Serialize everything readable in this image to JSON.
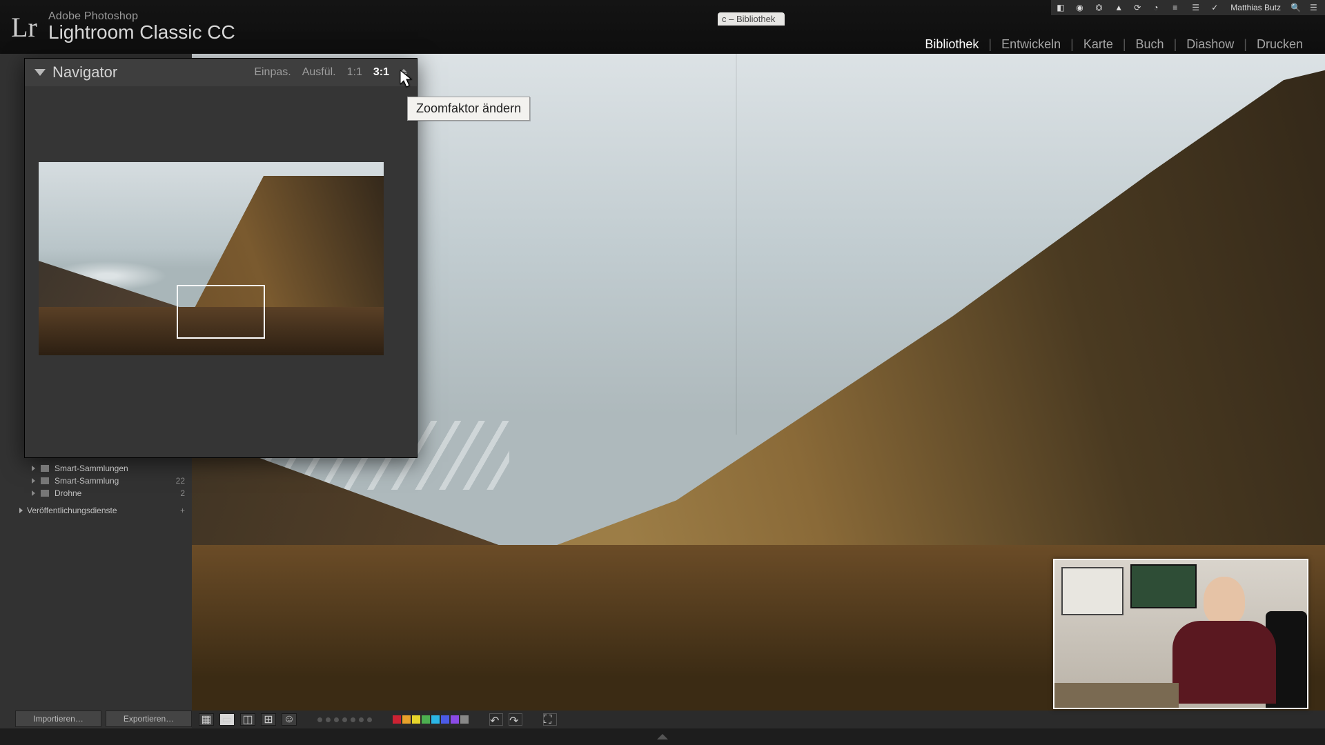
{
  "mac_menu": {
    "user": "Matthias Butz",
    "search_icon": "search",
    "window_hint": "c – Bibliothek"
  },
  "app": {
    "vendor": "Adobe Photoshop",
    "name": "Lightroom Classic CC",
    "logo_glyph": "Lr"
  },
  "modules": {
    "items": [
      "Bibliothek",
      "Entwickeln",
      "Karte",
      "Buch",
      "Diashow",
      "Drucken"
    ],
    "active_index": 0
  },
  "navigator": {
    "title": "Navigator",
    "zoom_options": {
      "fit": "Einpas.",
      "fill": "Ausfül.",
      "one": "1:1",
      "ratio": "3:1"
    },
    "active_zoom": "ratio",
    "tooltip": "Zoomfaktor ändern"
  },
  "collections": {
    "rows": [
      {
        "label": "Smart-Sammlungen",
        "count": ""
      },
      {
        "label": "Smart-Sammlung",
        "count": "22"
      },
      {
        "label": "Drohne",
        "count": "2"
      }
    ],
    "publish_header": "Veröffentlichungsdienste",
    "publish_add": "+"
  },
  "import_bar": {
    "import": "Importieren…",
    "export": "Exportieren…"
  },
  "toolbar": {
    "color_swatches": [
      "#c23",
      "#e7a12b",
      "#e7d52b",
      "#4caf50",
      "#2bb6e7",
      "#4b5be7",
      "#8a4be7",
      "#888"
    ]
  }
}
